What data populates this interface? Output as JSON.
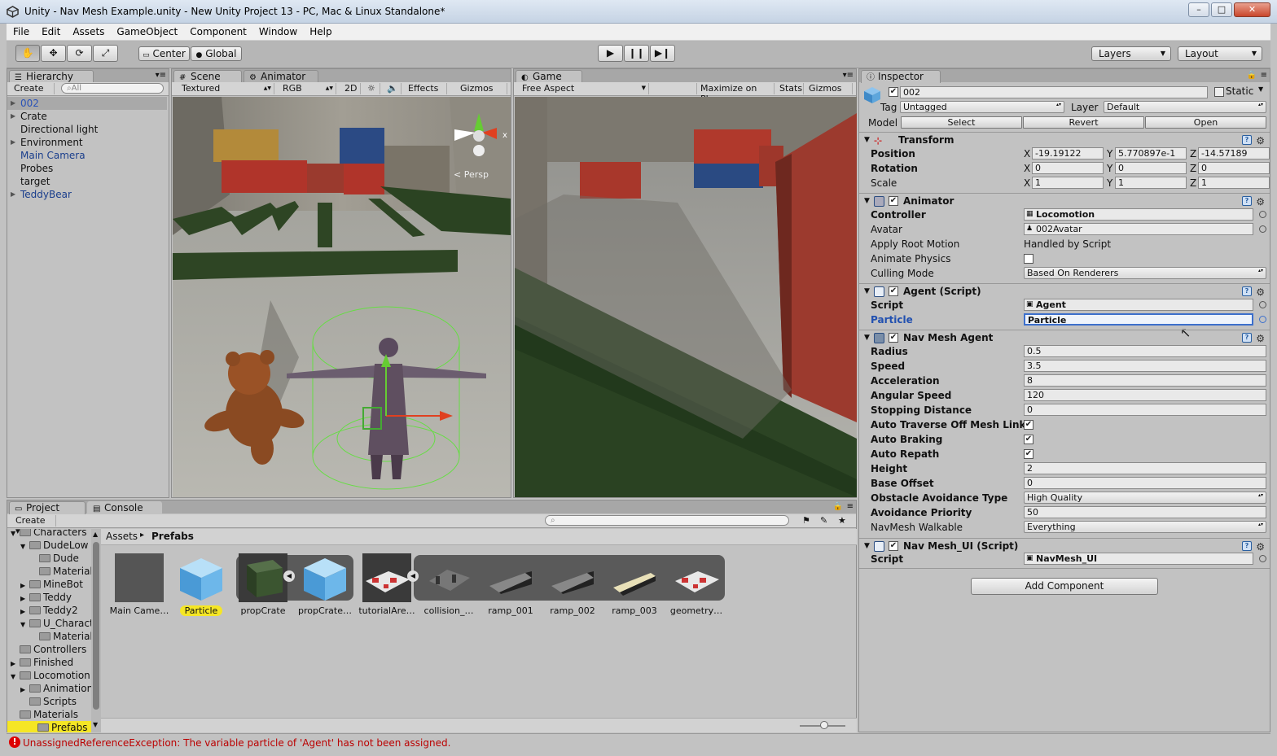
{
  "window": {
    "title": "Unity - Nav Mesh Example.unity - New Unity Project 13 - PC, Mac & Linux Standalone*",
    "minimize_label": "–",
    "maximize_label": "□",
    "close_label": "✕"
  },
  "menu": [
    "File",
    "Edit",
    "Assets",
    "GameObject",
    "Component",
    "Window",
    "Help"
  ],
  "toolbar": {
    "pivot_label": "Center",
    "space_label": "Global",
    "layers_label": "Layers",
    "layout_label": "Layout"
  },
  "hierarchy": {
    "tab": "Hierarchy",
    "create": "Create",
    "search_placeholder": "All",
    "items": [
      {
        "label": "002",
        "selected": true,
        "expandable": true
      },
      {
        "label": "Crate",
        "expandable": true
      },
      {
        "label": "Directional light"
      },
      {
        "label": "Environment",
        "expandable": true
      },
      {
        "label": "Main Camera",
        "blue": true
      },
      {
        "label": "Probes"
      },
      {
        "label": "target"
      },
      {
        "label": "TeddyBear",
        "blue": true,
        "expandable": true
      }
    ]
  },
  "scene": {
    "tab": "Scene",
    "animator_tab": "Animator",
    "shading": "Textured",
    "render_mode": "RGB",
    "mode_2d": "2D",
    "effects": "Effects",
    "gizmos": "Gizmos",
    "persp_label": "Persp"
  },
  "game": {
    "tab": "Game",
    "aspect": "Free Aspect",
    "maximize": "Maximize on Play",
    "stats": "Stats",
    "gizmos": "Gizmos"
  },
  "inspector": {
    "tab": "Inspector",
    "object_name": "002",
    "static_label": "Static",
    "tag_label": "Tag",
    "tag_value": "Untagged",
    "layer_label": "Layer",
    "layer_value": "Default",
    "model_label": "Model",
    "model_buttons": [
      "Select",
      "Revert",
      "Open"
    ],
    "transform": {
      "title": "Transform",
      "position_label": "Position",
      "rotation_label": "Rotation",
      "scale_label": "Scale",
      "position": [
        "-19.19122",
        "5.770897e-1",
        "-14.57189"
      ],
      "rotation": [
        "0",
        "0",
        "0"
      ],
      "scale": [
        "1",
        "1",
        "1"
      ],
      "axis": [
        "X",
        "Y",
        "Z"
      ]
    },
    "animator": {
      "title": "Animator",
      "rows": [
        {
          "label": "Controller",
          "value": "Locomotion"
        },
        {
          "label": "Avatar",
          "value": "002Avatar"
        },
        {
          "label": "Apply Root Motion",
          "value": "Handled by Script"
        },
        {
          "label": "Animate Physics"
        },
        {
          "label": "Culling Mode",
          "value": "Based On Renderers"
        }
      ]
    },
    "agent": {
      "title": "Agent (Script)",
      "script_label": "Script",
      "script_value": "Agent",
      "particle_label": "Particle",
      "particle_value": "Particle"
    },
    "navmesh": {
      "title": "Nav Mesh Agent",
      "rows": [
        {
          "label": "Radius",
          "value": "0.5"
        },
        {
          "label": "Speed",
          "value": "3.5"
        },
        {
          "label": "Acceleration",
          "value": "8"
        },
        {
          "label": "Angular Speed",
          "value": "120"
        },
        {
          "label": "Stopping Distance",
          "value": "0"
        },
        {
          "label": "Auto Traverse Off Mesh Link",
          "check": true
        },
        {
          "label": "Auto Braking",
          "check": true
        },
        {
          "label": "Auto Repath",
          "check": true
        },
        {
          "label": "Height",
          "value": "2"
        },
        {
          "label": "Base Offset",
          "value": "0"
        },
        {
          "label": "Obstacle Avoidance Type",
          "value": "High Quality",
          "dropdown": true
        },
        {
          "label": "Avoidance Priority",
          "value": "50"
        },
        {
          "label": "NavMesh Walkable",
          "value": "Everything",
          "dropdown": true
        }
      ]
    },
    "navui": {
      "title": "Nav Mesh_UI (Script)",
      "script_label": "Script",
      "script_value": "NavMesh_UI"
    },
    "add_component": "Add Component"
  },
  "project": {
    "tab": "Project",
    "console_tab": "Console",
    "create": "Create",
    "breadcrumb_root": "Assets",
    "breadcrumb_current": "Prefabs",
    "tree": [
      {
        "label": "Characters",
        "indent": 1,
        "open": true
      },
      {
        "label": "DudeLow",
        "indent": 2,
        "open": true
      },
      {
        "label": "Dude",
        "indent": 3
      },
      {
        "label": "Materials",
        "indent": 3
      },
      {
        "label": "MineBot",
        "indent": 2,
        "closed": true
      },
      {
        "label": "Teddy",
        "indent": 2,
        "closed": true
      },
      {
        "label": "Teddy2",
        "indent": 2,
        "closed": true
      },
      {
        "label": "U_Character",
        "indent": 2,
        "open": true
      },
      {
        "label": "Materials",
        "indent": 3
      },
      {
        "label": "Controllers",
        "indent": 1
      },
      {
        "label": "Finished",
        "indent": 1,
        "closed": true
      },
      {
        "label": "Locomotion",
        "indent": 1,
        "open": true
      },
      {
        "label": "Animations",
        "indent": 2,
        "closed": true
      },
      {
        "label": "Scripts",
        "indent": 2
      },
      {
        "label": "Materials",
        "indent": 1
      },
      {
        "label": "Prefabs",
        "indent": 1,
        "selected": true
      }
    ],
    "assets": [
      {
        "label": "Main Came…"
      },
      {
        "label": "Particle",
        "selected": true
      },
      {
        "label": "propCrate"
      },
      {
        "label": "propCrate…"
      },
      {
        "label": "tutorialAre…"
      },
      {
        "label": "collision_…"
      },
      {
        "label": "ramp_001"
      },
      {
        "label": "ramp_002"
      },
      {
        "label": "ramp_003"
      },
      {
        "label": "geometry…"
      }
    ]
  },
  "status": {
    "message": "UnassignedReferenceException: The variable particle of 'Agent' has not been assigned."
  }
}
